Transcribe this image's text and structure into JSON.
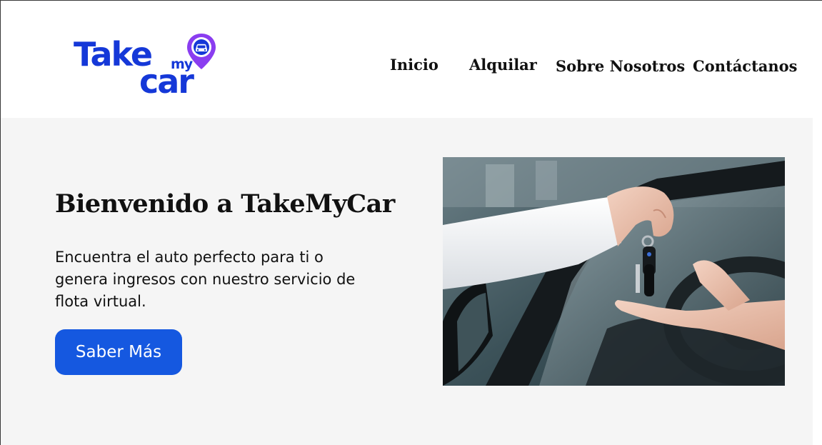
{
  "brand": {
    "logo_take": "Take",
    "logo_my": "my",
    "logo_car": "car",
    "color": "#1538d8",
    "pin_color": "#8a3df0"
  },
  "nav": {
    "items": [
      {
        "label": "Inicio"
      },
      {
        "label": "Alquilar"
      },
      {
        "label": "Sobre Nosotros"
      },
      {
        "label": "Contáctanos"
      }
    ]
  },
  "hero": {
    "title": "Bienvenido a TakeMyCar",
    "text": "Encuentra el auto perfecto para ti o genera ingresos con nuestro servicio de flota virtual.",
    "cta_label": "Saber Más",
    "cta_color": "#1558e0",
    "background": "#f5f5f5"
  }
}
